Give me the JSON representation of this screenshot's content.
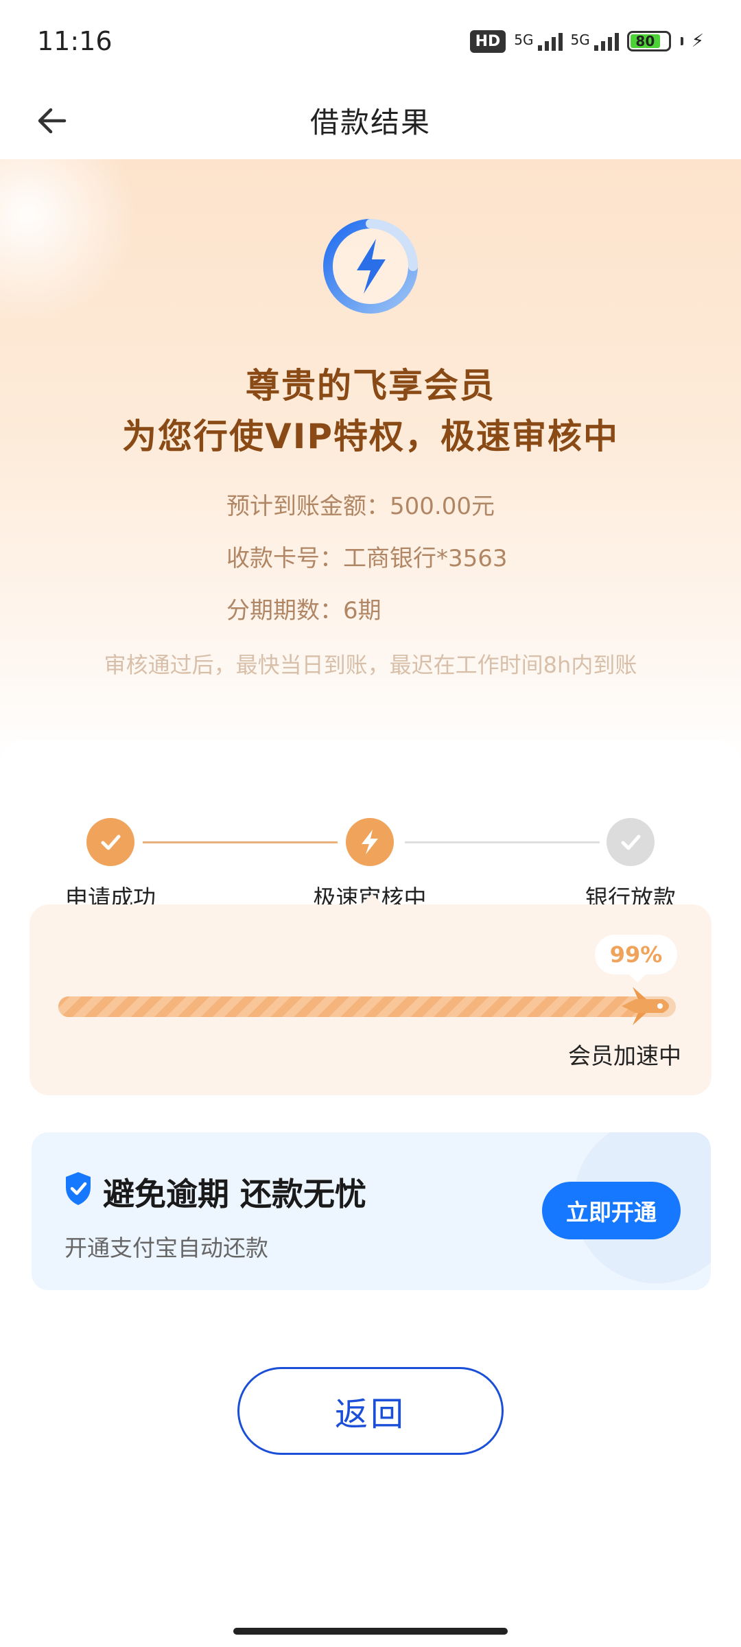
{
  "status_bar": {
    "time": "11:16",
    "hd_label": "HD",
    "signal1_label": "5G",
    "signal2_label": "5G",
    "battery": "80"
  },
  "header": {
    "title": "借款结果",
    "back_icon": "arrow-left-icon"
  },
  "hero": {
    "icon": "lightning-ring-icon",
    "title_line1": "尊贵的飞享会员",
    "title_line2": "为您行使VIP特权，极速审核中",
    "amount": "预计到账金额：500.00元",
    "card": "收款卡号：工商银行*3563",
    "installments": "分期期数：6期",
    "note": "审核通过后，最快当日到账，最迟在工作时间8h内到账"
  },
  "steps": [
    {
      "label": "申请成功",
      "state": "done",
      "icon": "check-icon"
    },
    {
      "label": "极速审核中",
      "state": "active",
      "icon": "lightning-icon"
    },
    {
      "label": "银行放款",
      "state": "pending",
      "icon": "check-icon"
    }
  ],
  "progress": {
    "percent_label": "99%",
    "value": 0.99,
    "status_label": "会员加速中"
  },
  "promo": {
    "title": "避免逾期 还款无忧",
    "subtitle": "开通支付宝自动还款",
    "button_label": "立即开通",
    "icon": "shield-check-icon"
  },
  "footer": {
    "return_label": "返回"
  },
  "colors": {
    "accent_orange": "#f0a35a",
    "title_brown": "#8a4a16",
    "primary_blue": "#1677ff",
    "return_blue": "#1b4fd8"
  }
}
